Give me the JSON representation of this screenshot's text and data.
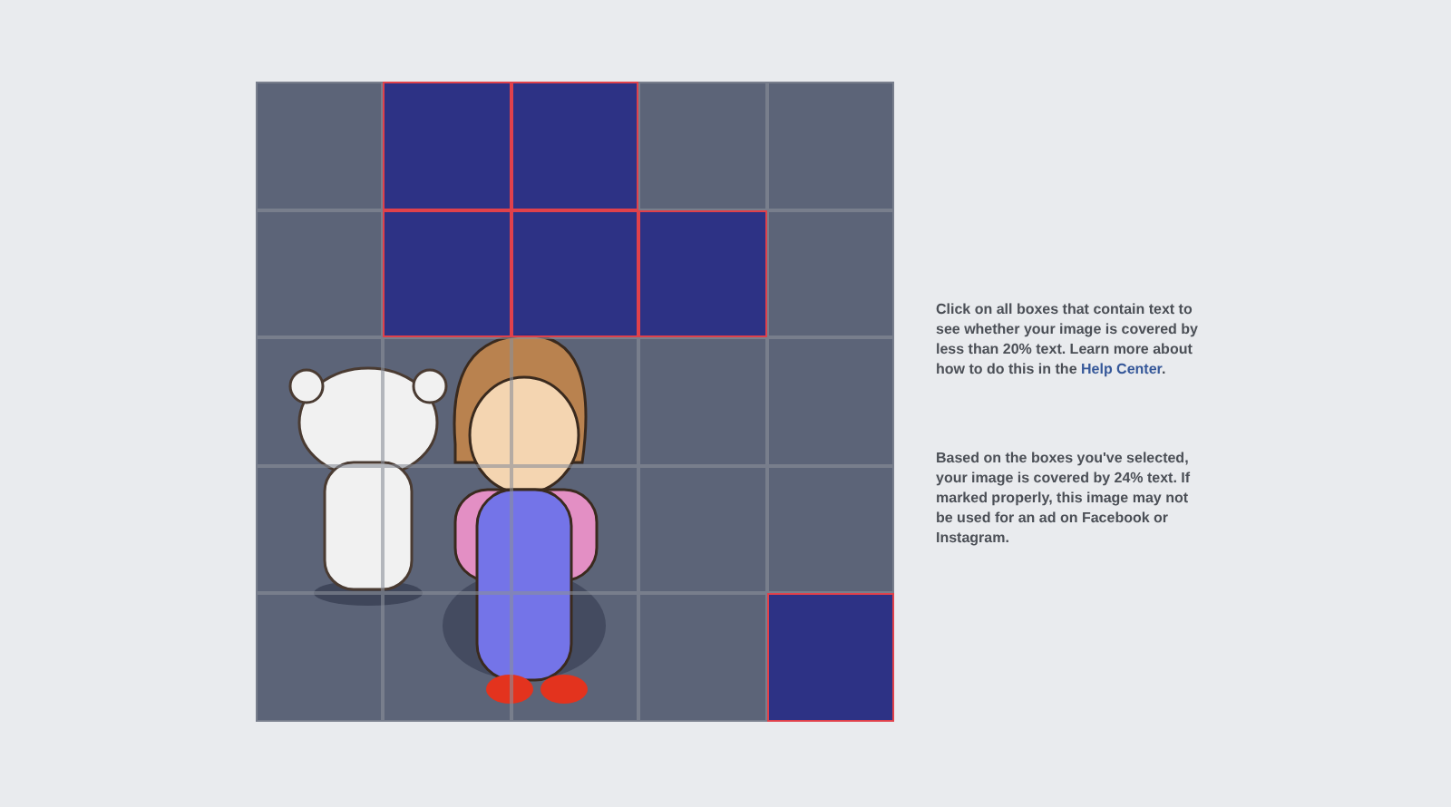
{
  "grid": {
    "rows": [
      [
        {
          "selected": false
        },
        {
          "selected": true
        },
        {
          "selected": true
        },
        {
          "selected": false
        },
        {
          "selected": false
        }
      ],
      [
        {
          "selected": false
        },
        {
          "selected": true
        },
        {
          "selected": true
        },
        {
          "selected": true
        },
        {
          "selected": false
        }
      ],
      [
        {
          "selected": false
        },
        {
          "selected": false
        },
        {
          "selected": false
        },
        {
          "selected": false
        },
        {
          "selected": false
        }
      ],
      [
        {
          "selected": false
        },
        {
          "selected": false
        },
        {
          "selected": false
        },
        {
          "selected": false
        },
        {
          "selected": false
        }
      ],
      [
        {
          "selected": false
        },
        {
          "selected": false
        },
        {
          "selected": false
        },
        {
          "selected": false
        },
        {
          "selected": true
        }
      ]
    ]
  },
  "instructions": {
    "text_before": "Click on all boxes that contain text to see whether your image is covered by less than 20% text. Learn more about how to do this in the ",
    "link": "Help Center",
    "text_after": "."
  },
  "result": "Based on the boxes you've selected, your image is covered by 24% text. If marked properly, this image may not be used for an ad on Facebook or Instagram."
}
